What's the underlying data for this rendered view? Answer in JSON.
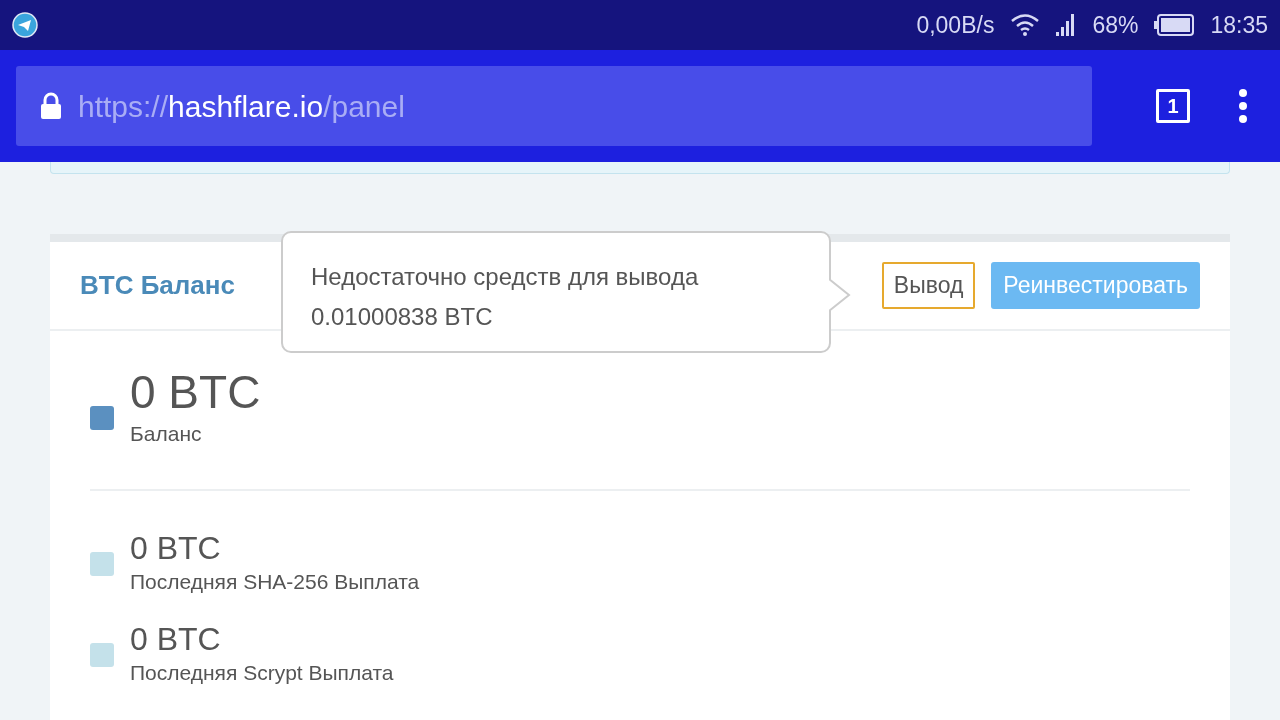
{
  "status_bar": {
    "net_speed": "0,00B/s",
    "battery": "68%",
    "time": "18:35"
  },
  "address_bar": {
    "scheme": "https://",
    "host": "hashflare.io",
    "path": "/panel",
    "tab_count": "1"
  },
  "balance_card": {
    "title": "BTC Баланс",
    "tooltip": "Недостаточно средств для вывода 0.01000838 BTC",
    "buttons": [
      {
        "label": "Вывод",
        "kind": "outline"
      },
      {
        "label": "Реинвестировать",
        "kind": "filled"
      }
    ],
    "stats": [
      {
        "value": "0 BTC",
        "label": "Баланс",
        "color": "#5b90c0",
        "kind": "main"
      },
      {
        "value": "0 BTC",
        "label": "Последняя SHA-256 Выплата",
        "color": "#c4e1ea",
        "kind": "minor"
      },
      {
        "value": "0 BTC",
        "label": "Последняя Scrypt Выплата",
        "color": "#c4e1ea",
        "kind": "minor"
      }
    ]
  }
}
